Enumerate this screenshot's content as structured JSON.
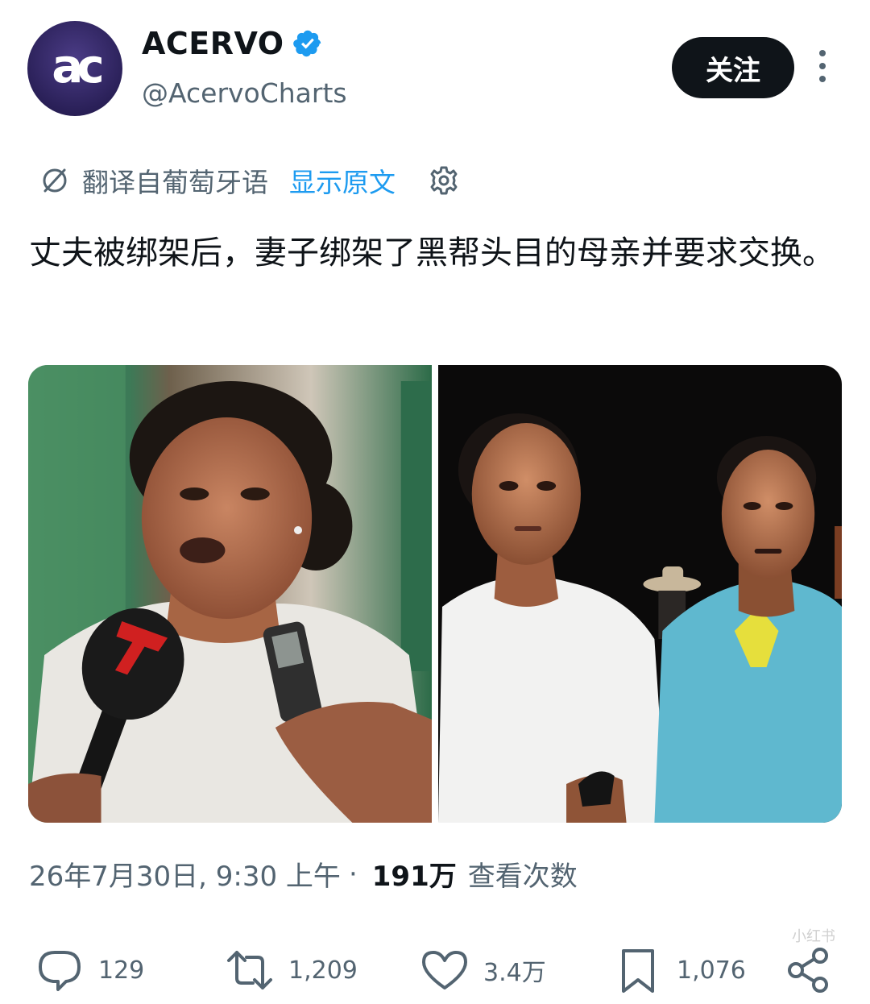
{
  "account": {
    "avatar_text": "ac",
    "display_name": "ACERVO",
    "handle": "@AcervoCharts",
    "verified_icon": "verified-badge-icon",
    "follow_label": "关注",
    "more_icon": "more-vertical-icon"
  },
  "translation": {
    "icon": "translate-icon",
    "label": "翻译自葡萄牙语",
    "show_original": "显示原文",
    "settings_icon": "gear-icon"
  },
  "tweet": {
    "text": "丈夫被绑架后，妻子绑架了黑帮头目的母亲并要求交换。"
  },
  "media": {
    "count": 2,
    "photo1_subject": "woman-speaking-into-microphones",
    "photo2_subject": "woman-and-man-at-night"
  },
  "meta": {
    "date": "26年7月30日, 9:30 上午",
    "separator": "·",
    "views": "191万",
    "views_label": "查看次数"
  },
  "actions": {
    "reply_count": "129",
    "retweet_count": "1,209",
    "like_count": "3.4万",
    "bookmark_count": "1,076"
  },
  "watermark": "小红书",
  "colors": {
    "accent_blue": "#1d9bf0",
    "text_primary": "#0f1419",
    "text_secondary": "#536471",
    "follow_button_bg": "#0f1419"
  }
}
